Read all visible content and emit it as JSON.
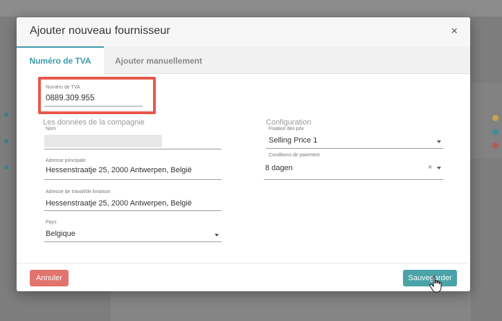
{
  "modal": {
    "title": "Ajouter nouveau fournisseur",
    "close_symbol": "×",
    "tabs": [
      {
        "label": "Numéro de TVA",
        "active": true
      },
      {
        "label": "Ajouter manuellement",
        "active": false
      }
    ]
  },
  "vat": {
    "label": "Numéro de TVA",
    "value": "0889.309.955"
  },
  "company": {
    "section_label": "Les données de la compagnie",
    "name_label": "Nom",
    "address_label": "Adresse principale",
    "address_value": "Hessenstraatje 25, 2000 Antwerpen, België",
    "work_address_label": "Adresse de travail/de livraison",
    "work_address_value": "Hessenstraatje 25, 2000 Antwerpen, België",
    "country_label": "Pays",
    "country_value": "Belgique"
  },
  "configuration": {
    "section_label": "Configuration",
    "pricing_label": "Fixation des prix",
    "pricing_value": "Selling Price 1",
    "payment_label": "Conditions de paiement",
    "payment_value": "8 dagen",
    "clear_symbol": "×"
  },
  "footer": {
    "cancel_label": "Annuler",
    "save_label": "Sauvegarder"
  },
  "colors": {
    "accent": "#3a9aa9",
    "highlight": "#e8574b",
    "cancel": "#e2736d",
    "save": "#4aa3a7"
  }
}
